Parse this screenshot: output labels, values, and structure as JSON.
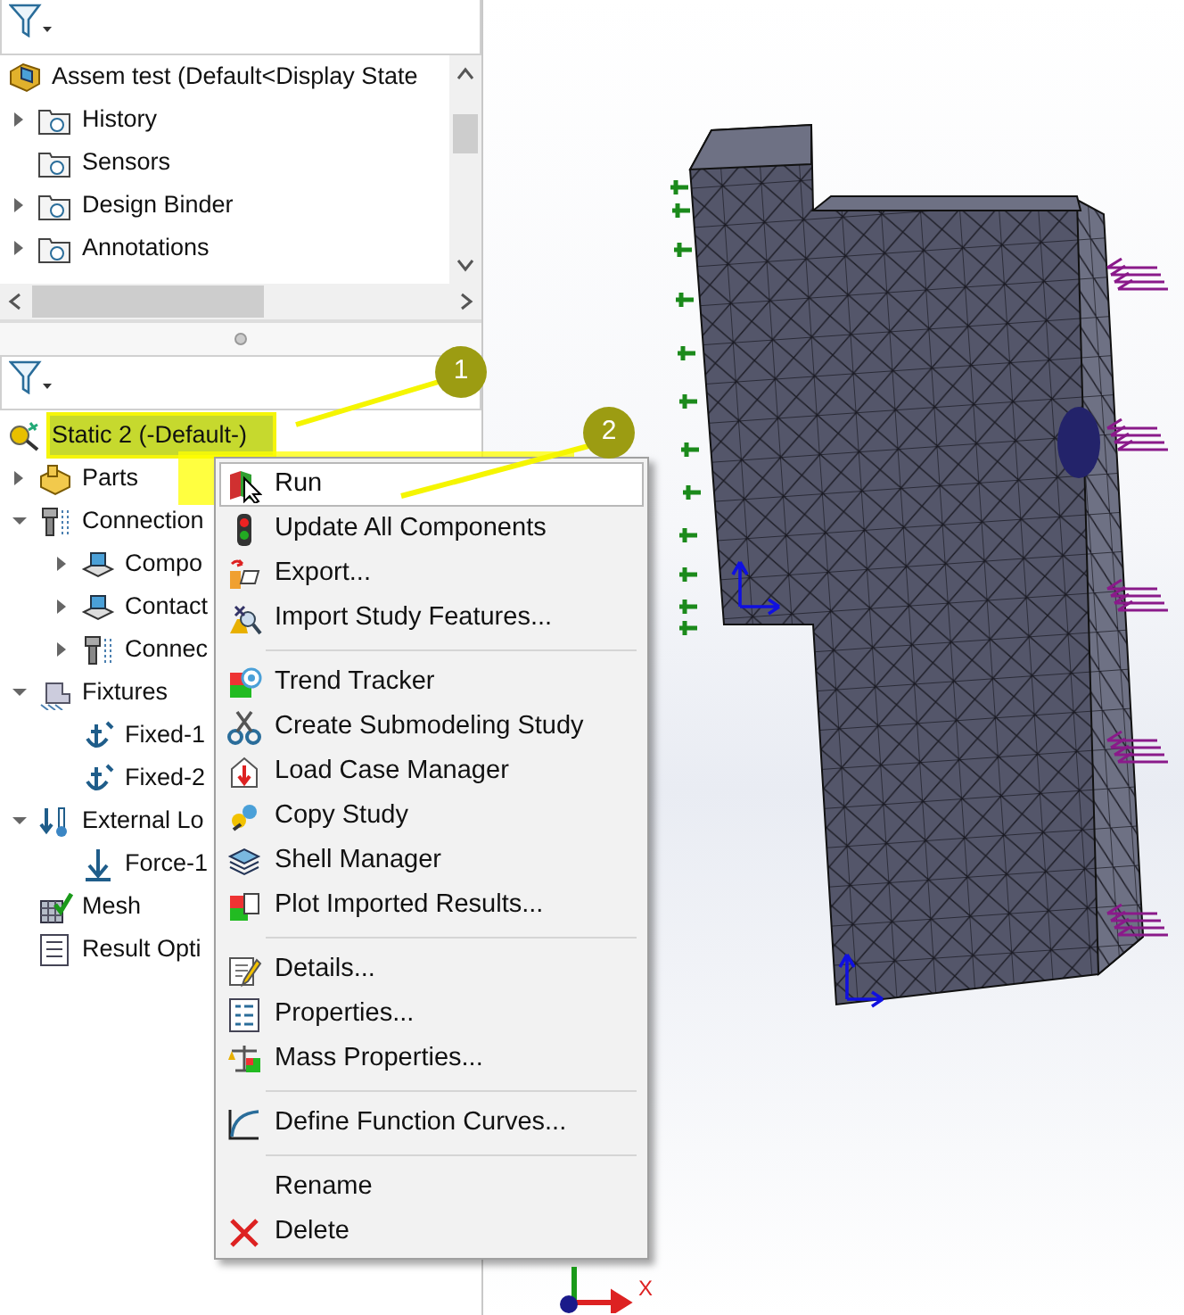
{
  "top_tree": {
    "items": [
      {
        "label": "Assem test  (Default<Display State",
        "children": [
          {
            "label": "History",
            "expanded": false
          },
          {
            "label": "Sensors"
          },
          {
            "label": "Design Binder",
            "expanded": false
          },
          {
            "label": "Annotations",
            "expanded": false
          }
        ]
      }
    ]
  },
  "study_tree": {
    "items": [
      {
        "label": "Static 2 (-Default-)",
        "selected": true,
        "children": [
          {
            "label": "Parts",
            "expanded": false,
            "selected": false
          },
          {
            "label": "Connection",
            "expanded": true,
            "selected": false,
            "children": [
              {
                "label": "Compo",
                "expanded": false,
                "selected": false
              },
              {
                "label": "Contact",
                "expanded": false,
                "selected": false
              },
              {
                "label": "Connec",
                "expanded": false,
                "selected": false
              }
            ]
          },
          {
            "label": "Fixtures",
            "expanded": true,
            "selected": false,
            "children": [
              {
                "label": "Fixed-1",
                "selected": false
              },
              {
                "label": "Fixed-2",
                "selected": false
              }
            ]
          },
          {
            "label": "External Lo",
            "expanded": true,
            "selected": false,
            "children": [
              {
                "label": "Force-1",
                "selected": false
              }
            ]
          },
          {
            "label": "Mesh",
            "selected": false
          },
          {
            "label": "Result Opti",
            "selected": false
          }
        ]
      }
    ]
  },
  "context_menu": {
    "items": [
      {
        "kind": "item",
        "label": "Run",
        "hovered": true
      },
      {
        "kind": "item",
        "label": "Update All Components",
        "hovered": false
      },
      {
        "kind": "item",
        "label": "Export...",
        "hovered": false
      },
      {
        "kind": "item",
        "label": "Import Study Features...",
        "hovered": false
      },
      {
        "kind": "separator"
      },
      {
        "kind": "item",
        "label": "Trend Tracker",
        "hovered": false
      },
      {
        "kind": "item",
        "label": "Create Submodeling Study",
        "hovered": false
      },
      {
        "kind": "item",
        "label": "Load Case Manager",
        "hovered": false
      },
      {
        "kind": "item",
        "label": "Copy Study",
        "hovered": false
      },
      {
        "kind": "item",
        "label": "Shell Manager",
        "hovered": false
      },
      {
        "kind": "item",
        "label": "Plot Imported Results...",
        "hovered": false
      },
      {
        "kind": "separator"
      },
      {
        "kind": "item",
        "label": "Details...",
        "hovered": false
      },
      {
        "kind": "item",
        "label": "Properties...",
        "hovered": false
      },
      {
        "kind": "item",
        "label": "Mass Properties...",
        "hovered": false
      },
      {
        "kind": "separator"
      },
      {
        "kind": "item",
        "label": "Define Function Curves...",
        "hovered": false
      },
      {
        "kind": "separator"
      },
      {
        "kind": "item",
        "label": "Rename",
        "hovered": false
      },
      {
        "kind": "item",
        "label": "Delete",
        "hovered": false
      }
    ]
  },
  "callouts": [
    {
      "number": "1"
    },
    {
      "number": "2"
    }
  ],
  "viewport": {
    "triad_label": "X"
  }
}
